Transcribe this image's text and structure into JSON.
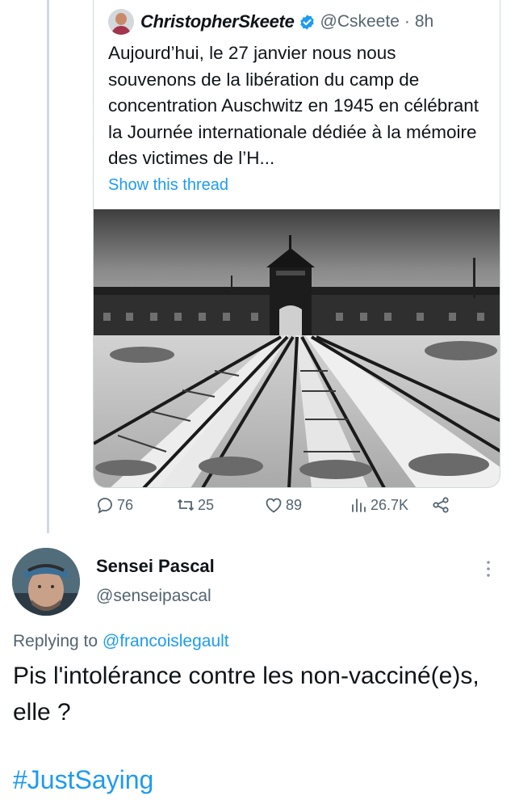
{
  "quoted_tweet": {
    "author_name": "ChristopherSkeete",
    "author_handle": "@Cskeete",
    "separator": "·",
    "time": "8h",
    "text": "Aujourd’hui, le 27 janvier nous nous souvenons de la libération du camp de concentration Auschwitz en 1945 en célébrant la Journée internationale dédiée à la mémoire des victimes de l’H...",
    "show_thread_label": "Show this thread",
    "image_icon": "photo-railway-gate"
  },
  "stats": {
    "replies": "76",
    "retweets": "25",
    "likes": "89",
    "views": "26.7K"
  },
  "icons": {
    "reply": "reply-icon",
    "retweet": "retweet-icon",
    "like": "heart-icon",
    "views": "views-icon",
    "share": "share-icon",
    "more": "more-vertical-icon",
    "verified": "verified-badge-icon"
  },
  "reply_tweet": {
    "author_name": "Sensei Pascal",
    "author_handle": "@senseipascal",
    "replying_prefix": "Replying to",
    "replying_to": "@francoislegault",
    "text": "Pis l'intolérance contre les non-vacciné(e)s, elle ?",
    "hashtag": "#JustSaying"
  },
  "colors": {
    "accent": "#1d9bf0",
    "secondary_text": "#536471",
    "border": "#cfd9de"
  }
}
